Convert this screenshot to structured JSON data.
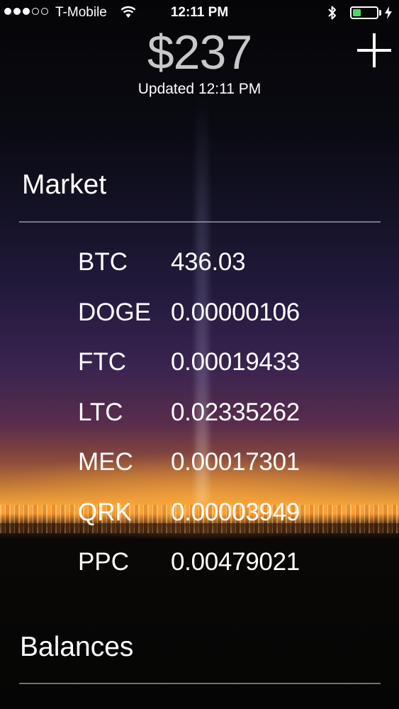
{
  "status_bar": {
    "carrier": "T-Mobile",
    "time": "12:11 PM",
    "signal_bars_filled": 3,
    "signal_bars_total": 5,
    "battery_level": 0.35,
    "icons": [
      "signal-icon",
      "wifi-icon",
      "bluetooth-icon",
      "battery-icon",
      "charging-icon"
    ],
    "battery_color": "#4cd964"
  },
  "header": {
    "total": "$237",
    "updated": "Updated 12:11 PM",
    "add_icon": "plus-icon"
  },
  "market": {
    "title": "Market",
    "rows": [
      {
        "symbol": "BTC",
        "price": "436.03"
      },
      {
        "symbol": "DOGE",
        "price": "0.00000106"
      },
      {
        "symbol": "FTC",
        "price": "0.00019433"
      },
      {
        "symbol": "LTC",
        "price": "0.02335262"
      },
      {
        "symbol": "MEC",
        "price": "0.00017301"
      },
      {
        "symbol": "QRK",
        "price": "0.00003949"
      },
      {
        "symbol": "PPC",
        "price": "0.00479021"
      }
    ]
  },
  "balances": {
    "title": "Balances"
  }
}
